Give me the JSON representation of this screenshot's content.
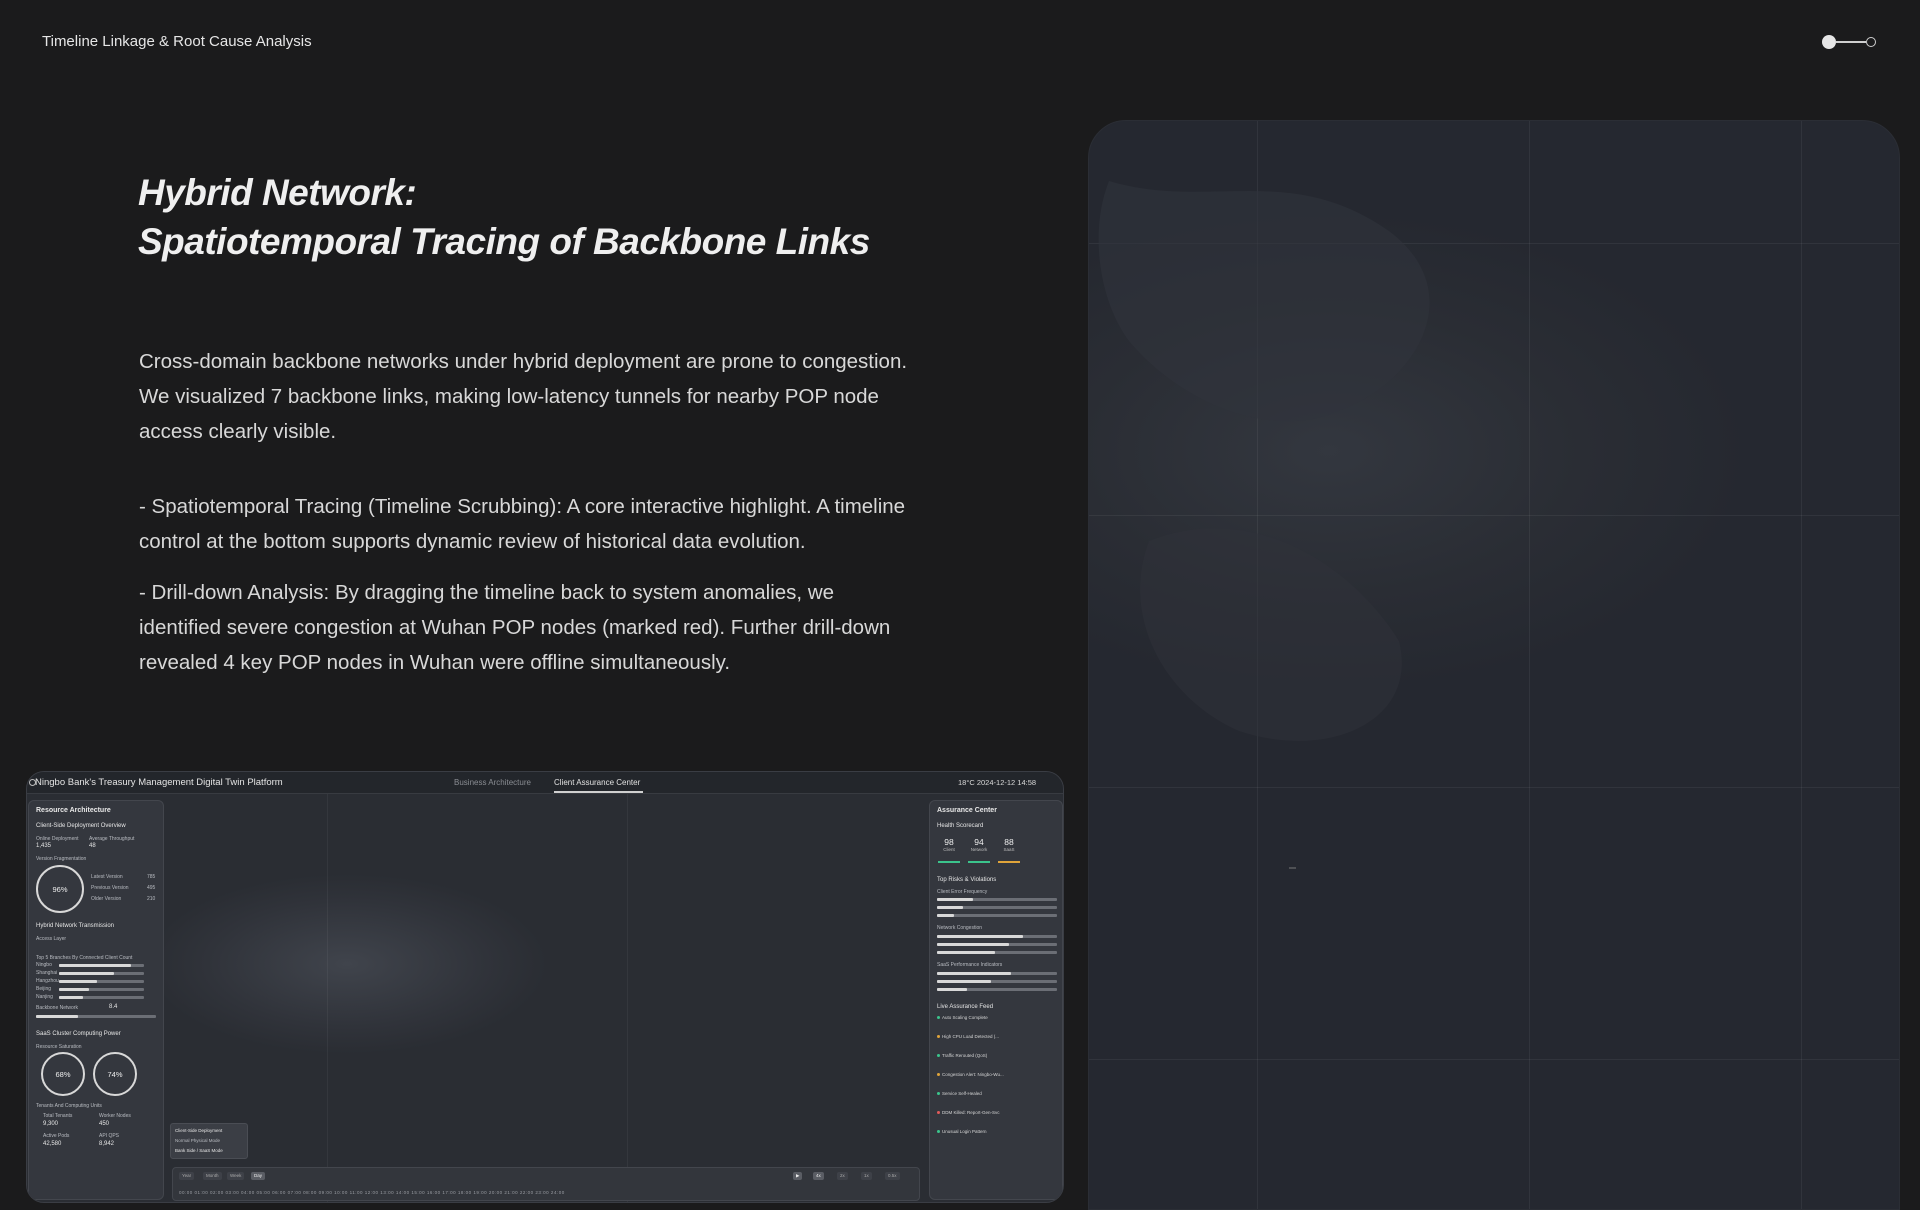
{
  "header": {
    "title": "Timeline Linkage & Root Cause Analysis"
  },
  "headline": {
    "line1": "Hybrid Network:",
    "line2": "Spatiotemporal Tracing of Backbone Links"
  },
  "body": {
    "p1_line1": "Cross-domain backbone networks under hybrid deployment are prone to congestion.",
    "p1_line2": "We visualized 7 backbone links, making low-latency tunnels for nearby POP node",
    "p1_line3": "access clearly visible.",
    "p2_line1": "- Spatiotemporal Tracing (Timeline Scrubbing): A core interactive highlight. A timeline",
    "p2_line2": "control at the bottom supports dynamic review of historical data evolution.",
    "p3_line1": "- Drill-down Analysis: By dragging the timeline back to system anomalies, we",
    "p3_line2": "identified severe congestion at Wuhan POP nodes (marked red). Further drill-down",
    "p3_line3": "revealed 4 key POP nodes in Wuhan were offline simultaneously."
  },
  "dashboard": {
    "brand": "Ningbo Bank's Treasury Management Digital Twin Platform",
    "tab_business": "Business Architecture",
    "tab_client": "Client Assurance Center",
    "status": "18°C   2024-12-12   14:58",
    "left": {
      "header": "Resource Architecture",
      "client_overview": "Client-Side Deployment Overview",
      "online_deployment": "Online Deployment",
      "online_value": "1,435",
      "avg_throughput": "Average Throughput",
      "throughput_value": "48",
      "version_frag": "Version Fragmentation",
      "ring_value": "96%",
      "latest": "Latest Version",
      "latest_v": "785",
      "previous": "Previous Version",
      "previous_v": "495",
      "older": "Older Version",
      "older_v": "210",
      "hybrid": "Hybrid Network Transmission",
      "access_layer": "Access Layer",
      "top_branches": "Top 5 Branches By Connected Client Count",
      "branches": [
        "Ningbo",
        "Shanghai",
        "Hangzhou",
        "Beijing",
        "Nanjing"
      ],
      "branch_fills": [
        0.85,
        0.65,
        0.45,
        0.35,
        0.28
      ],
      "backbone": "Backbone Network",
      "backbone_value": "8.4",
      "saas": "SaaS Cluster Computing Power",
      "resource_sat": "Resource Saturation",
      "cpu_value": "68%",
      "mem_value": "74%",
      "tenants": "Tenants And Computing Units",
      "total_tenants": "Total Tenants",
      "total_tenants_v": "9,300",
      "worker_nodes": "Worker Nodes",
      "worker_nodes_v": "450",
      "active_pods": "Active Pods",
      "active_pods_v": "42,580",
      "api_qps": "API QPS",
      "api_qps_v": "8,942"
    },
    "right": {
      "header": "Assurance Center",
      "health": "Health Scorecard",
      "scores": [
        {
          "n": "98",
          "l": "Client"
        },
        {
          "n": "94",
          "l": "Network"
        },
        {
          "n": "88",
          "l": "SaaS"
        }
      ],
      "top_risks": "Top Risks & Violations",
      "client_err": "Client Error Frequency",
      "net_cong": "Network Congestion",
      "saas_perf": "SaaS Performance Indicators",
      "live_feed": "Live Assurance Feed",
      "feed": [
        "Auto Scaling Complete",
        "High CPU Load Detected (...",
        "Traffic Rerouted (QoS)",
        "Congestion Alert: Ningbo-Wu...",
        "Service Self-Healed",
        "DDM Killed: Report-Gen-Svc",
        "Unusual Login Pattern"
      ],
      "feed_colors": [
        "#3bc48c",
        "#e0a43a",
        "#3bc48c",
        "#e0a43a",
        "#3bc48c",
        "#e05a5a",
        "#3bc48c"
      ]
    },
    "popup": {
      "l1": "Client-Side Deployment",
      "l2": "Normal Physical Mode",
      "l3": "Bank Side / SaaS Mode"
    },
    "timeline": {
      "modes": [
        "Year",
        "Month",
        "Week",
        "Day"
      ],
      "speeds": [
        "4x",
        "2x",
        "1x",
        "0.5x"
      ],
      "ticks": "00:00  01:00  02:00  03:00  04:00  05:00  06:00  07:00  08:00  09:00  10:00  11:00  12:00  13:00  14:00  15:00  16:00  17:00  18:00  19:00  20:00  21:00  22:00  23:00  24:00"
    }
  },
  "colors": {
    "background": "#1b1b1c",
    "panel": "#2a2d34",
    "accent_ok": "#3bc48c",
    "accent_warn": "#e0a43a",
    "accent_alert": "#e05a5a"
  }
}
